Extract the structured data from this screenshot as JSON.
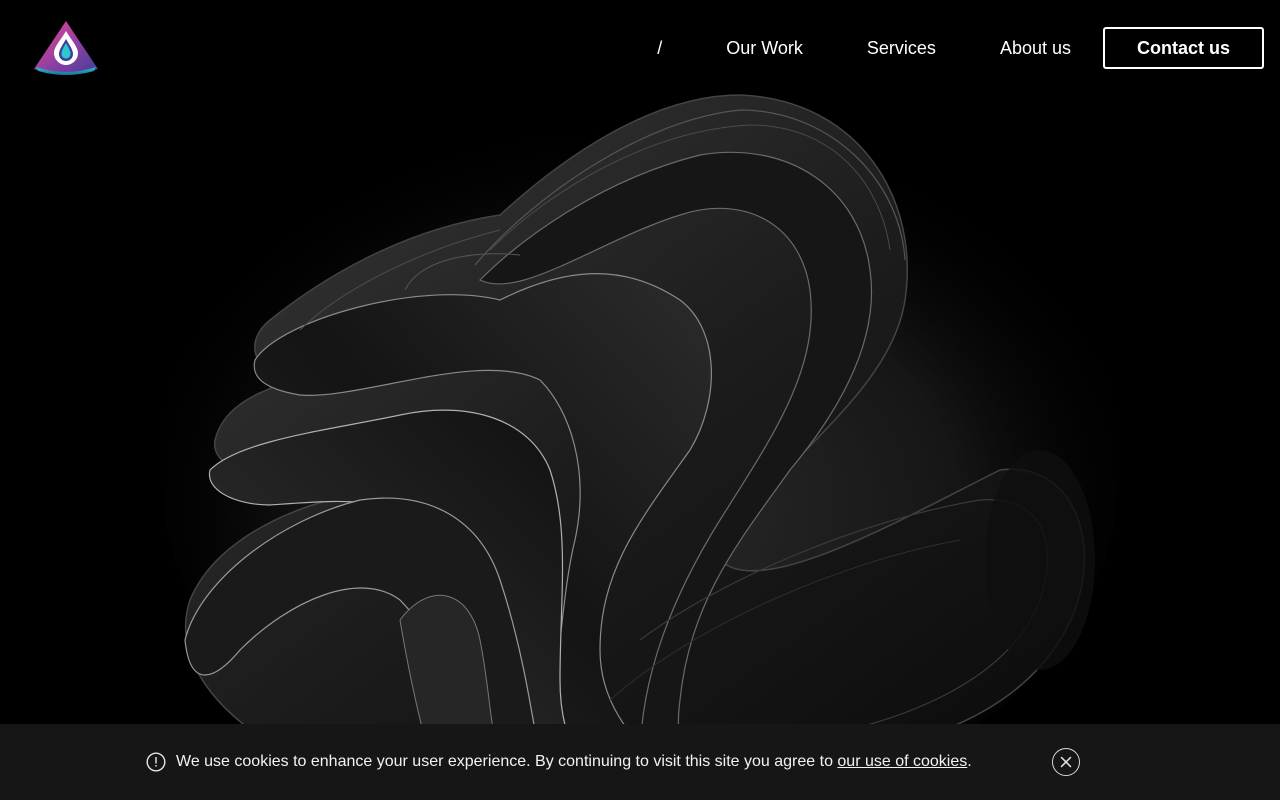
{
  "header": {
    "logo_icon": "droplet-triangle-logo-icon",
    "nav": [
      {
        "label": "/"
      },
      {
        "label": "Our Work"
      },
      {
        "label": "Services"
      },
      {
        "label": "About us"
      }
    ],
    "contact_label": "Contact us"
  },
  "hero": {
    "art": "abstract-dark-ribbon-sculpture"
  },
  "cookie_banner": {
    "info_icon": "info-circle-icon",
    "text": "We use cookies to enhance your user experience. By continuing to visit this site you agree to ",
    "link_label": "our use of cookies",
    "suffix": ".",
    "close_icon": "close-circle-icon"
  },
  "colors": {
    "background": "#000000",
    "banner_background": "#161616",
    "text": "#ffffff",
    "logo_pink": "#e9428c",
    "logo_purple": "#6a3fa0",
    "logo_teal": "#27c4c8"
  }
}
